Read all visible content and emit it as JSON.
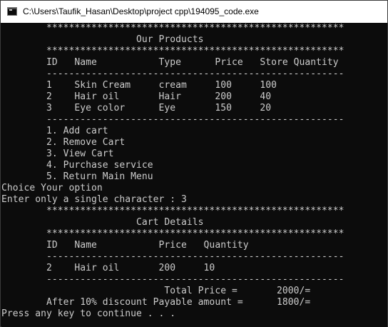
{
  "window": {
    "title": "C:\\Users\\Taufik_Hasan\\Desktop\\project cpp\\194095_code.exe"
  },
  "console": {
    "lines": [
      "        *****************************************************",
      "                        Our Products",
      "        *****************************************************",
      "        ID   Name           Type      Price   Store Quantity",
      "        -----------------------------------------------------",
      "        1    Skin Cream     cream     100     100",
      "        2    Hair oil       Hair      200     40",
      "        3    Eye color      Eye       150     20",
      "        -----------------------------------------------------",
      "        1. Add cart",
      "        2. Remove Cart",
      "        3. View Cart",
      "        4. Purchase service",
      "        5. Return Main Menu",
      "Choice Your option",
      "Enter only a single character : 3",
      "        *****************************************************",
      "                        Cart Details",
      "        *****************************************************",
      "        ID   Name           Price   Quantity",
      "        -----------------------------------------------------",
      "        2    Hair oil       200     10",
      "        -----------------------------------------------------",
      "                             Total Price =       2000/=",
      "        After 10% discount Payable amount =      1800/=",
      "Press any key to continue . . ."
    ]
  }
}
